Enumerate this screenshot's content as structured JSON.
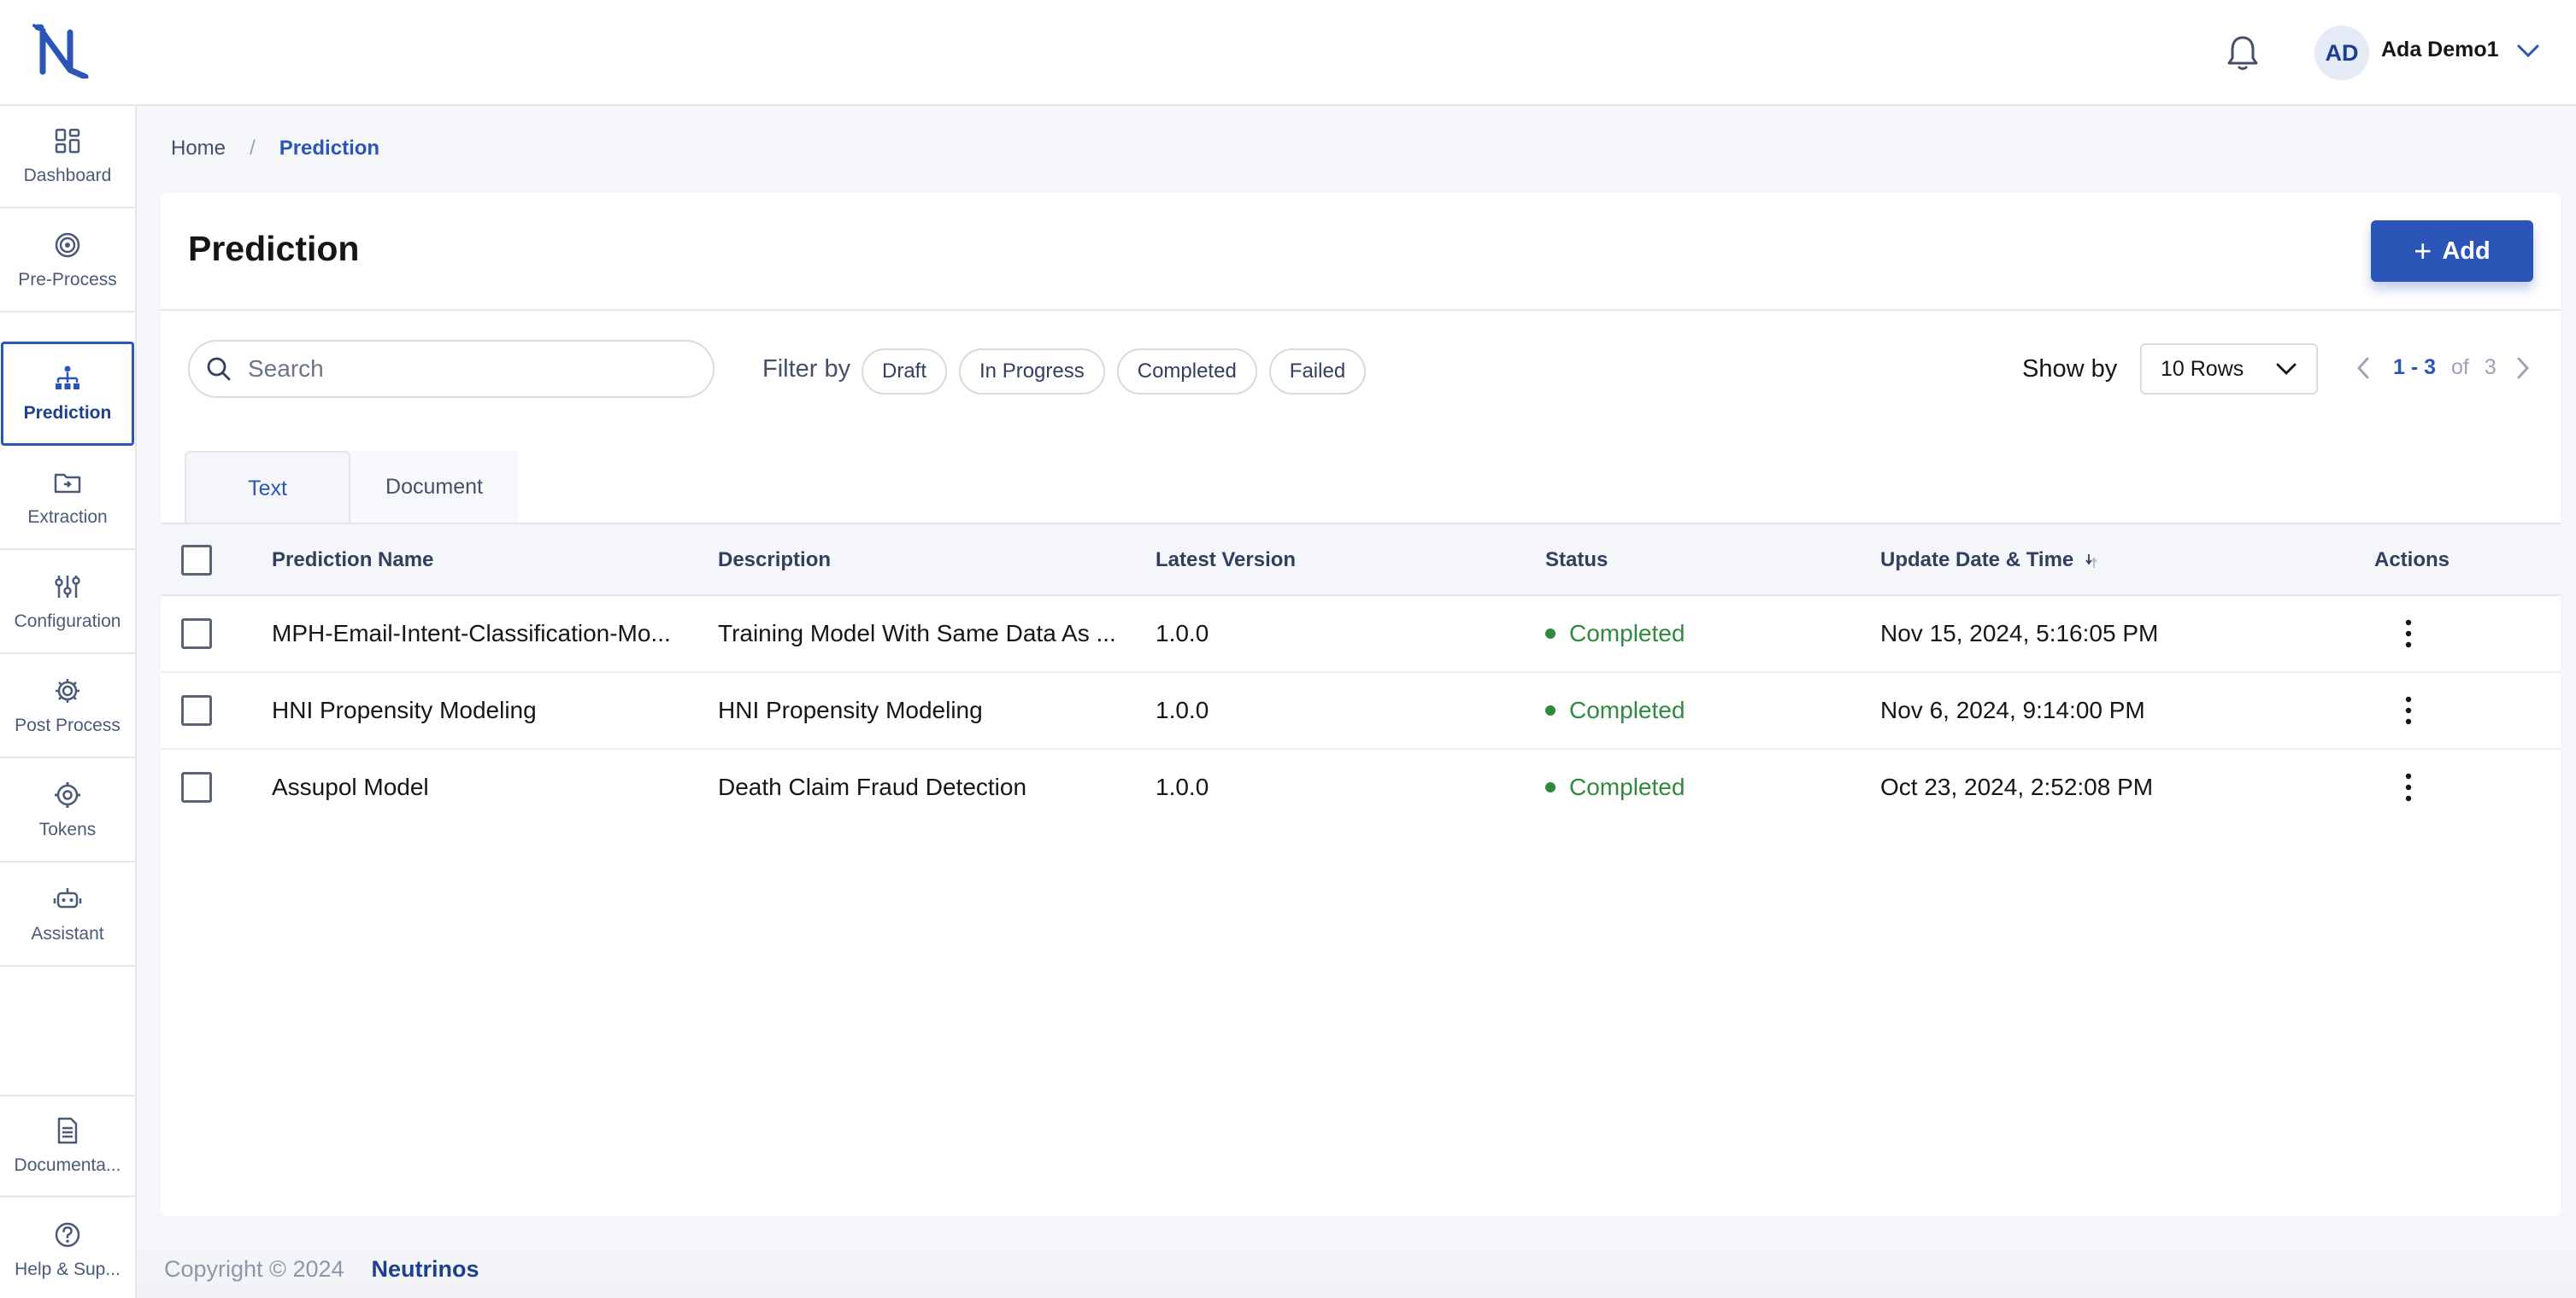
{
  "header": {
    "avatar_initials": "AD",
    "user_name": "Ada Demo1"
  },
  "sidebar": {
    "items": [
      {
        "label": "Dashboard",
        "icon": "dashboard-icon"
      },
      {
        "label": "Pre-Process",
        "icon": "target-icon"
      },
      {
        "label": "Prediction",
        "icon": "hierarchy-icon",
        "active": true
      },
      {
        "label": "Extraction",
        "icon": "folder-icon"
      },
      {
        "label": "Configuration",
        "icon": "sliders-icon"
      },
      {
        "label": "Post Process",
        "icon": "gear-icon"
      },
      {
        "label": "Tokens",
        "icon": "gear-cog-icon"
      },
      {
        "label": "Assistant",
        "icon": "robot-icon"
      }
    ],
    "bottom_items": [
      {
        "label": "Documenta...",
        "icon": "document-icon"
      },
      {
        "label": "Help & Sup...",
        "icon": "help-icon"
      }
    ]
  },
  "breadcrumb": {
    "home": "Home",
    "separator": "/",
    "current": "Prediction"
  },
  "main": {
    "title": "Prediction",
    "add_label": "Add",
    "search_placeholder": "Search",
    "filter_label": "Filter by",
    "filters": [
      "Draft",
      "In Progress",
      "Completed",
      "Failed"
    ],
    "show_by_label": "Show by",
    "rows_value": "10 Rows",
    "pager": {
      "range": "1 - 3",
      "of": "of",
      "total": "3"
    },
    "tabs": [
      {
        "label": "Text",
        "active": true
      },
      {
        "label": "Document",
        "active": false
      }
    ]
  },
  "table": {
    "columns": [
      "Prediction Name",
      "Description",
      "Latest Version",
      "Status",
      "Update Date & Time",
      "Actions"
    ],
    "rows": [
      {
        "name": "MPH-Email-Intent-Classification-Mo...",
        "description": "Training Model With Same Data As ...",
        "version": "1.0.0",
        "status": "Completed",
        "updated": "Nov 15, 2024, 5:16:05 PM"
      },
      {
        "name": "HNI Propensity Modeling",
        "description": "HNI Propensity Modeling",
        "version": "1.0.0",
        "status": "Completed",
        "updated": "Nov 6, 2024, 9:14:00 PM"
      },
      {
        "name": "Assupol Model",
        "description": "Death Claim Fraud Detection",
        "version": "1.0.0",
        "status": "Completed",
        "updated": "Oct 23, 2024, 2:52:08 PM"
      }
    ]
  },
  "footer": {
    "copyright": "Copyright © 2024",
    "brand": "Neutrinos"
  },
  "colors": {
    "primary": "#2c55b8",
    "primary_dark": "#1c3f8f",
    "status_completed": "#2f8a3e",
    "background": "#f4f6fa"
  }
}
